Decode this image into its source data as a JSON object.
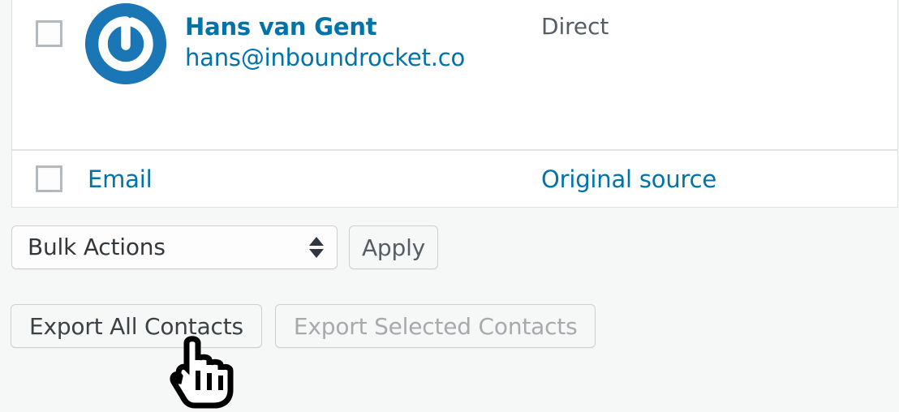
{
  "table": {
    "contact": {
      "checkbox_checked": false,
      "avatar_icon": "gravatar-logo-icon",
      "avatar_color": "#1b76b5",
      "name": "Hans van Gent",
      "email": "hans@inboundrocket.co",
      "original_source": "Direct"
    },
    "footer_header": {
      "checkbox_checked": false,
      "col_email": "Email",
      "col_original_source": "Original source"
    }
  },
  "bulk_actions": {
    "select_value": "Bulk Actions",
    "select_options": [
      "Bulk Actions"
    ],
    "apply_label": "Apply",
    "dropdown_icon": "up-down-arrows-icon"
  },
  "export": {
    "export_all_label": "Export All Contacts",
    "export_selected_label": "Export Selected Contacts",
    "export_selected_disabled": true
  },
  "cursor": {
    "icon": "pointing-hand-cursor"
  },
  "colors": {
    "link": "#0073aa",
    "page_background": "#f6f7f7",
    "text": "#555d66",
    "border": "#e1e1e1"
  }
}
